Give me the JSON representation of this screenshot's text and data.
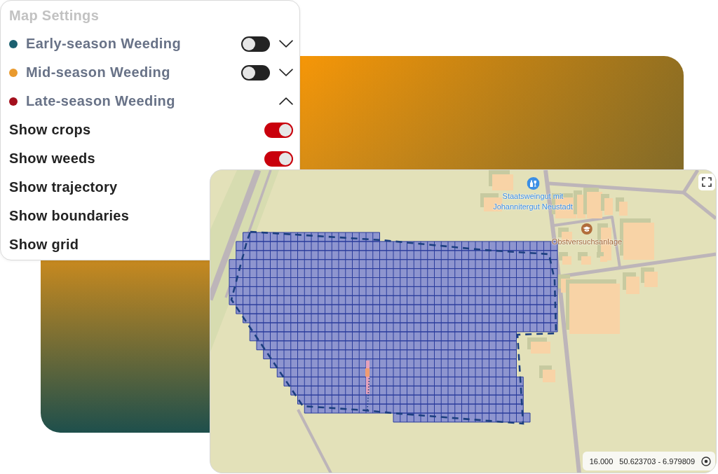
{
  "panel": {
    "title": "Map Settings",
    "layers": [
      {
        "label": "Early-season Weeding",
        "color": "#1b6070",
        "on": false,
        "expanded": false
      },
      {
        "label": "Mid-season Weeding",
        "color": "#e99a2e",
        "on": false,
        "expanded": false
      },
      {
        "label": "Late-season Weeding",
        "color": "#a30f1c",
        "expanded": true
      }
    ],
    "options": [
      {
        "label": "Show crops",
        "on": true
      },
      {
        "label": "Show weeds",
        "on": true
      },
      {
        "label": "Show trajectory"
      },
      {
        "label": "Show boundaries"
      },
      {
        "label": "Show grid"
      }
    ]
  },
  "map": {
    "places": [
      {
        "name": "Staatsweingut mit Johannitergut Neustadt",
        "kind": "winery"
      },
      {
        "name": "Obstversuchsanlage",
        "kind": "school"
      }
    ],
    "zoom": "16.000",
    "coordinates": "50.623703 - 6.979809"
  }
}
